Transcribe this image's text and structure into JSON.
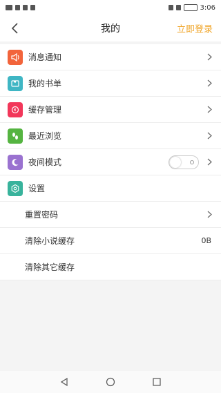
{
  "status_bar": {
    "time": "3:06"
  },
  "header": {
    "title": "我的",
    "login_label": "立即登录"
  },
  "menu": {
    "items": [
      {
        "label": "消息通知",
        "icon": "speaker-icon",
        "color": "#f2643b"
      },
      {
        "label": "我的书单",
        "icon": "book-list-icon",
        "color": "#3fb6c4"
      },
      {
        "label": "缓存管理",
        "icon": "cache-icon",
        "color": "#f2375a"
      },
      {
        "label": "最近浏览",
        "icon": "footprint-icon",
        "color": "#55b441"
      },
      {
        "label": "夜间模式",
        "icon": "moon-icon",
        "color": "#9a72d0"
      },
      {
        "label": "设置",
        "icon": "settings-icon",
        "color": "#38b39c"
      }
    ],
    "settings": {
      "reset_password": "重置密码",
      "clear_novel_cache": "清除小说缓存",
      "clear_novel_cache_value": "0B",
      "clear_other_cache": "清除其它缓存"
    }
  },
  "colors": {
    "accent": "#f0a62b"
  }
}
